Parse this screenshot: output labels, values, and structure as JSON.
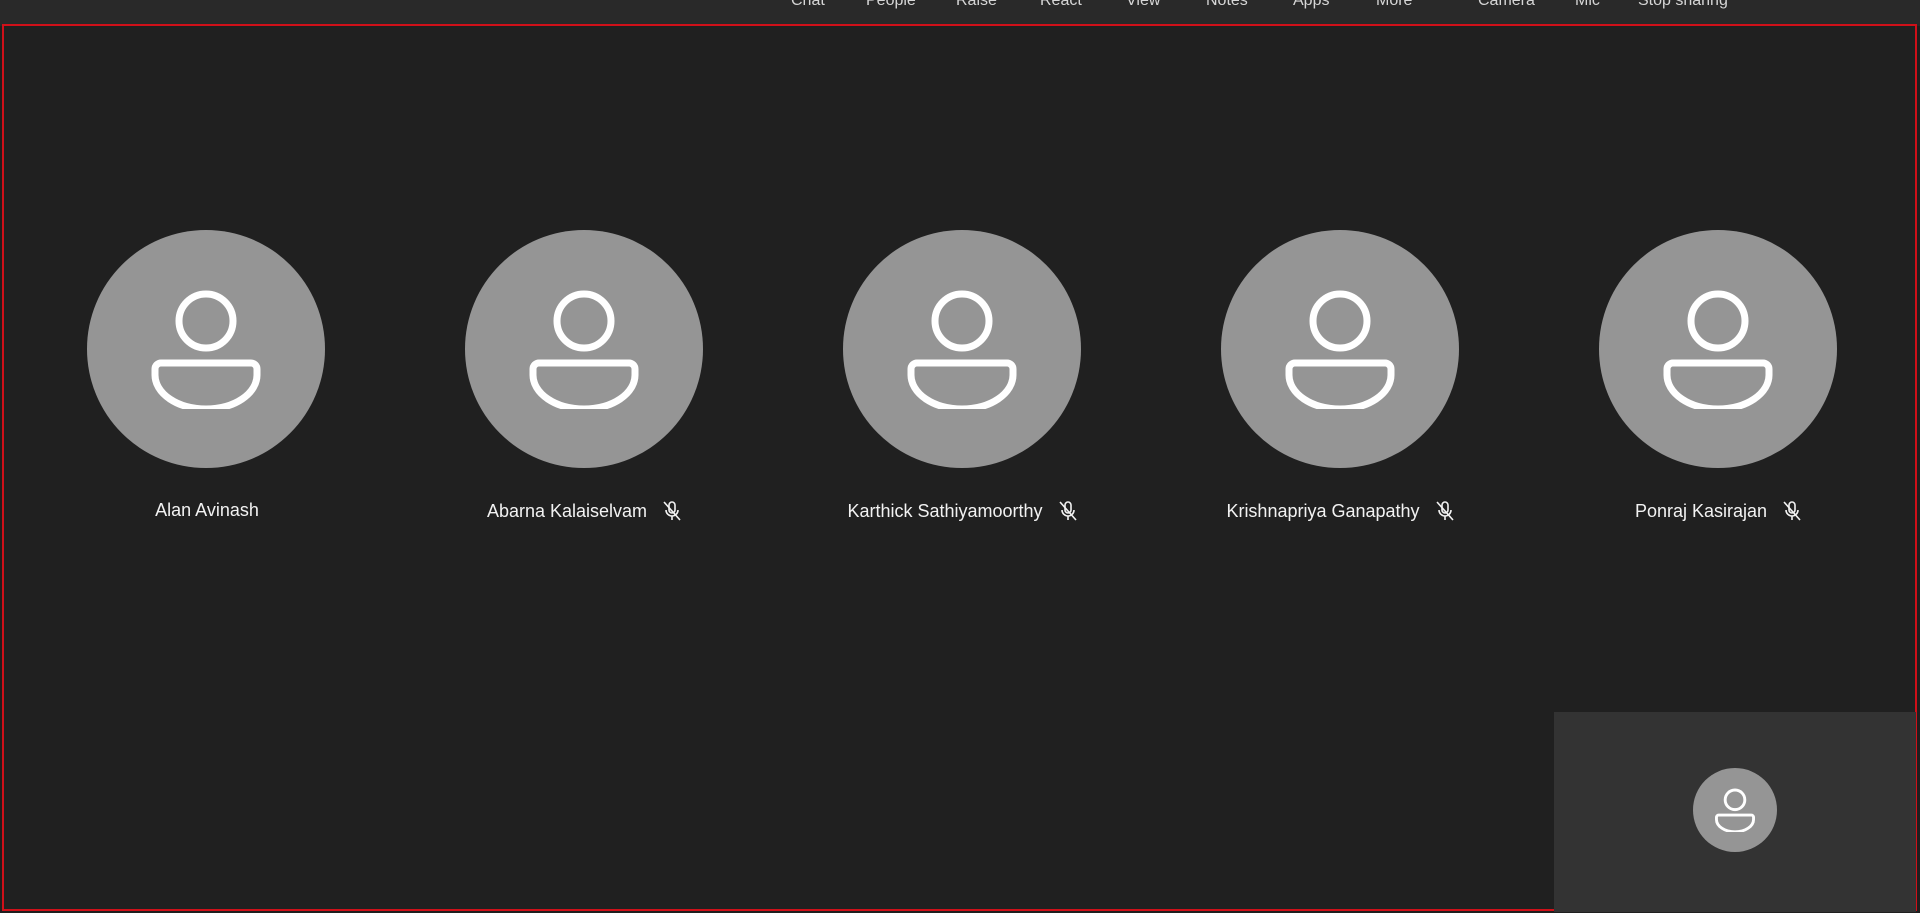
{
  "toolbar": {
    "items": [
      {
        "label": "Chat",
        "icon": "chat-icon"
      },
      {
        "label": "People",
        "icon": "people-icon"
      },
      {
        "label": "Raise",
        "icon": "hand-icon"
      },
      {
        "label": "React",
        "icon": "react-icon"
      },
      {
        "label": "View",
        "icon": "view-icon"
      },
      {
        "label": "Notes",
        "icon": "notes-icon"
      },
      {
        "label": "Apps",
        "icon": "apps-icon"
      },
      {
        "label": "More",
        "icon": "more-icon"
      },
      {
        "label": "Camera",
        "icon": "camera-icon"
      },
      {
        "label": "Mic",
        "icon": "mic-icon"
      },
      {
        "label": "Stop sharing",
        "icon": "stop-sharing-icon"
      }
    ]
  },
  "participants": [
    {
      "name": "Alan Avinash",
      "muted": false
    },
    {
      "name": "Abarna Kalaiselvam",
      "muted": true
    },
    {
      "name": "Karthick Sathiyamoorthy",
      "muted": true
    },
    {
      "name": "Krishnapriya Ganapathy",
      "muted": true
    },
    {
      "name": "Ponraj Kasirajan",
      "muted": true
    }
  ],
  "colors": {
    "background": "#1f1f1f",
    "share_border": "#d01019",
    "avatar_fill": "#959595",
    "self_view_bg": "#333333"
  }
}
